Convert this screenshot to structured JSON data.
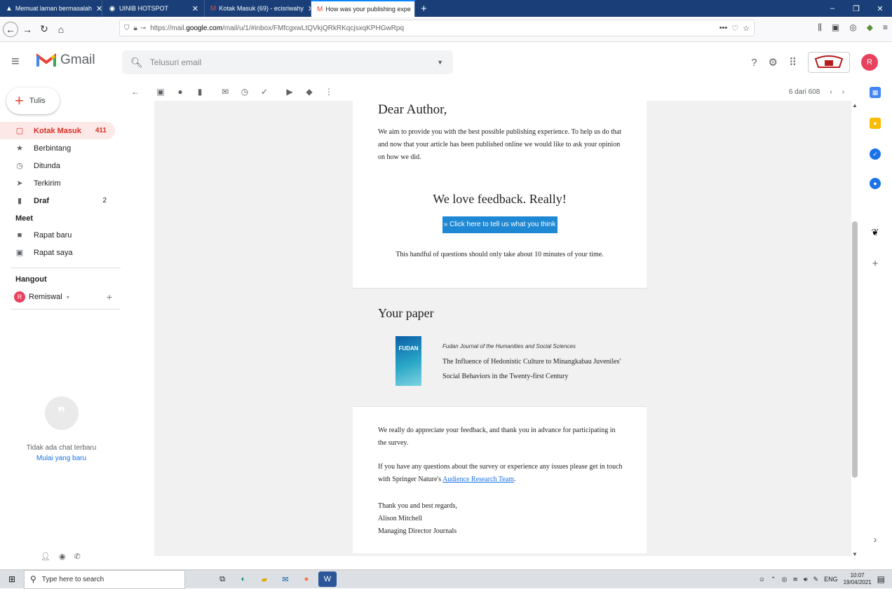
{
  "browser": {
    "tabs": [
      {
        "title": "Memuat laman bermasalah",
        "icon": "warning-icon"
      },
      {
        "title": "UINIB HOTSPOT",
        "icon": "globe-icon"
      },
      {
        "title": "Kotak Masuk (69) - ecisriwahy",
        "icon": "gmail-icon"
      },
      {
        "title": "How was your publishing expe",
        "icon": "gmail-icon",
        "active": true
      }
    ],
    "url_prefix": "https://mail.",
    "url_host": "google.com",
    "url_rest": "/mail/u/1/#inbox/FMfcgxwLtQVkjQRkRKqcjsxqKPHGwRpq",
    "url_menu": "•••"
  },
  "gmail": {
    "app_name": "Gmail",
    "search_placeholder": "Telusuri email",
    "avatar_letter": "R"
  },
  "sidebar": {
    "compose_label": "Tulis",
    "items": [
      {
        "label": "Kotak Masuk",
        "count": "411",
        "icon": "inbox-icon"
      },
      {
        "label": "Berbintang",
        "count": "",
        "icon": "star-icon"
      },
      {
        "label": "Ditunda",
        "count": "",
        "icon": "clock-icon"
      },
      {
        "label": "Terkirim",
        "count": "",
        "icon": "send-icon"
      },
      {
        "label": "Draf",
        "count": "2",
        "icon": "draft-icon"
      }
    ],
    "meet_title": "Meet",
    "meet_items": [
      {
        "label": "Rapat baru",
        "icon": "video-icon"
      },
      {
        "label": "Rapat saya",
        "icon": "calendar-icon"
      }
    ],
    "hangout_title": "Hangout",
    "hangout_user": "Remiswal",
    "hangout_user_initial": "R",
    "chat_empty_text": "Tidak ada chat terbaru",
    "chat_start_link": "Mulai yang baru"
  },
  "toolbar": {
    "pager_text": "6 dari 608"
  },
  "email": {
    "greeting": "Dear Author,",
    "intro": "We aim to provide you with the best possible publishing experience. To help us do that and now that your article has been published online we would like to ask your opinion on how we did.",
    "headline": "We love feedback. Really!",
    "cta_label": "» Click here to tell us what you think",
    "handful": "This handful of questions should only take about 10 minutes of your time.",
    "paper_heading": "Your paper",
    "cover_text": "FUDAN",
    "journal": "Fudan Journal of the Humanities and Social Sciences",
    "paper_title": "The Influence of Hedonistic Culture to Minangkabau Juveniles' Social Behaviors in the Twenty-first Century",
    "appreciate": "We really do appreciate your feedback, and thank you in advance for participating in the survey.",
    "questions_pre": "If you have any questions about the survey or experience any issues please get in touch with Springer Nature's ",
    "questions_link": "Audience Research Team",
    "questions_post": ".",
    "thanks": "Thank you and best regards,",
    "signer": "Alison Mitchell",
    "signer_role": "Managing Director Journals"
  },
  "taskbar": {
    "search_placeholder": "Type here to search",
    "lang": "ENG",
    "time": "10:07",
    "date": "19/04/2021"
  },
  "colors": {
    "accent": "#d93025",
    "link": "#1a73e8",
    "cta": "#1e88d4",
    "tabbar": "#1a3f78"
  }
}
